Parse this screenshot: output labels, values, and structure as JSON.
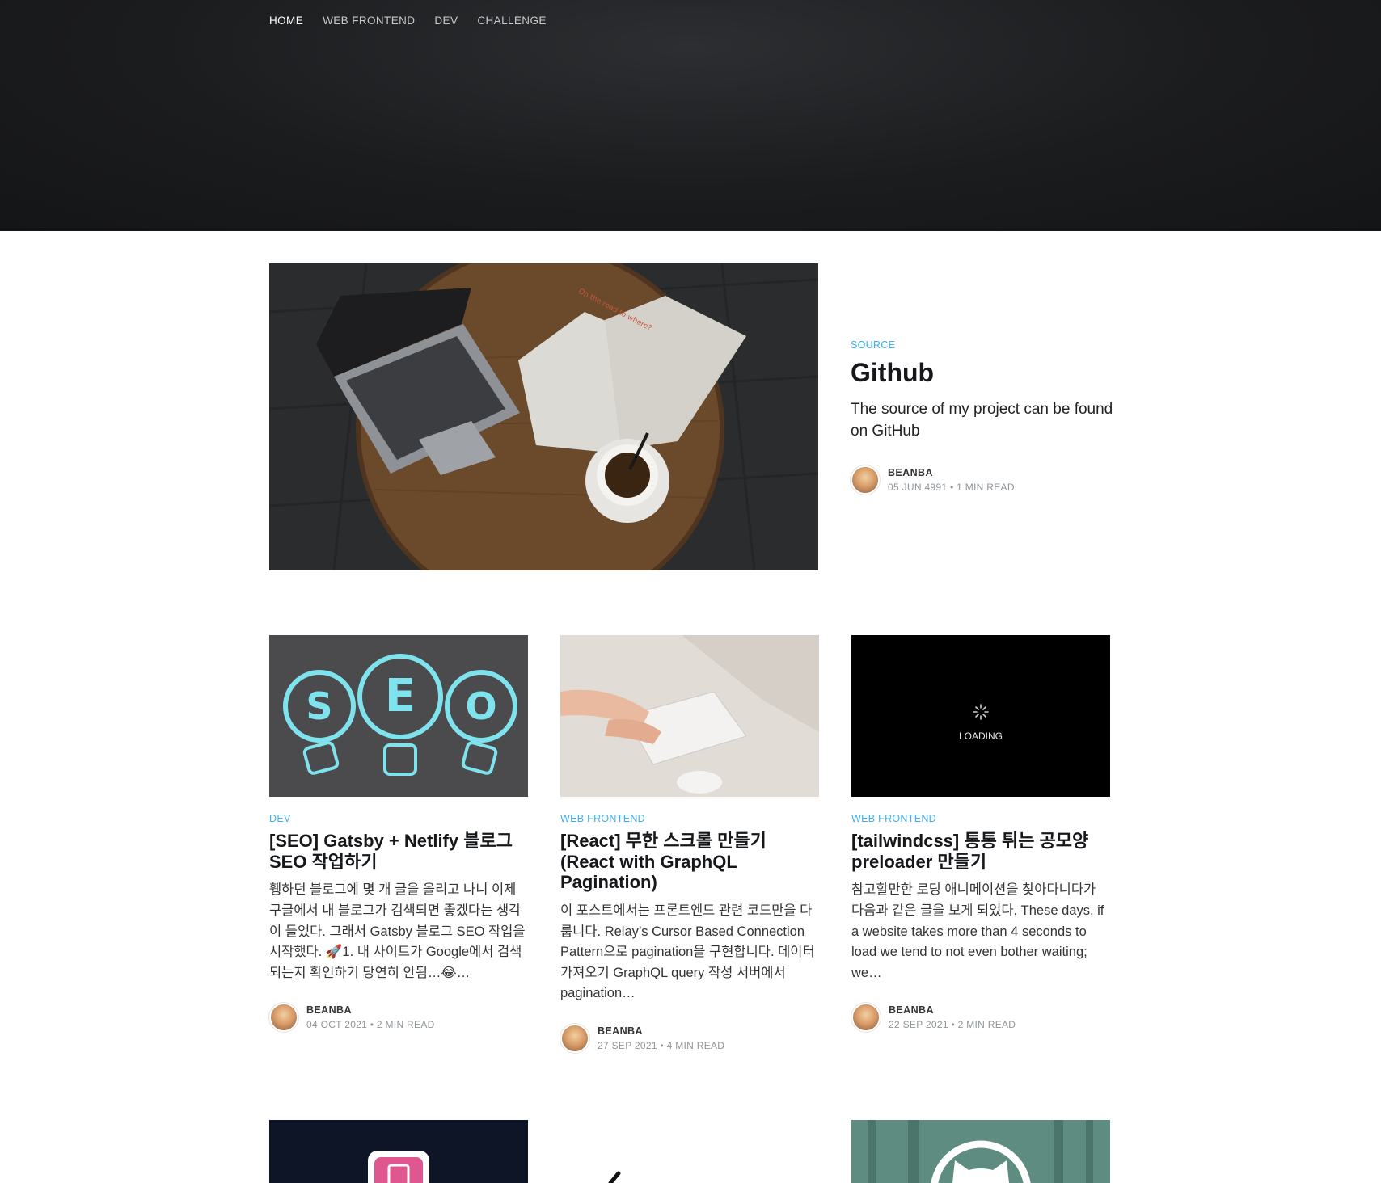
{
  "nav": {
    "items": [
      {
        "label": "HOME"
      },
      {
        "label": "WEB FRONTEND"
      },
      {
        "label": "DEV"
      },
      {
        "label": "CHALLENGE"
      }
    ]
  },
  "featured": {
    "tag": "SOURCE",
    "title": "Github",
    "excerpt": "The source of my project can be found on GitHub",
    "author": "BEANBA",
    "date": "05 JUN 4991",
    "read_time": "1 MIN READ",
    "image_text": "On the road to where?"
  },
  "posts": [
    {
      "tag": "DEV",
      "title": "[SEO] Gatsby + Netlify 블로그 SEO 작업하기",
      "excerpt": "휑하던 블로그에 몇 개 글을 올리고 나니 이제 구글에서 내 블로그가 검색되면 좋겠다는 생각이 들었다. 그래서 Gatsby 블로그 SEO 작업을 시작했다. 🚀1. 내 사이트가 Google에서 검색되는지 확인하기 당연히 안됨…😂…",
      "author": "BEANBA",
      "date": "04 OCT 2021",
      "read_time": "2 MIN READ",
      "image_letters": [
        "S",
        "E",
        "O"
      ]
    },
    {
      "tag": "WEB FRONTEND",
      "title": "[React] 무한 스크롤 만들기 (React with GraphQL Pagination)",
      "excerpt": "이 포스트에서는 프론트엔드 관련 코드만을 다룹니다. Relay’s Cursor Based Connection Pattern으로 pagination을 구현합니다. 데이터 가져오기 GraphQL query 작성 서버에서 pagination…",
      "author": "BEANBA",
      "date": "27 SEP 2021",
      "read_time": "4 MIN READ"
    },
    {
      "tag": "WEB FRONTEND",
      "title": "[tailwindcss] 통통 튀는 공모양 preloader 만들기",
      "excerpt": "참고할만한 로딩 애니메이션을 찾아다니다가 다음과 같은 글을 보게 되었다. These days, if a website takes more than 4 seconds to load we tend to not even bother waiting; we…",
      "author": "BEANBA",
      "date": "22 SEP 2021",
      "read_time": "2 MIN READ",
      "image_text": "LOADING"
    }
  ],
  "colors": {
    "accent": "#3eb0ef",
    "hero_bg": "#1b1c1e"
  }
}
